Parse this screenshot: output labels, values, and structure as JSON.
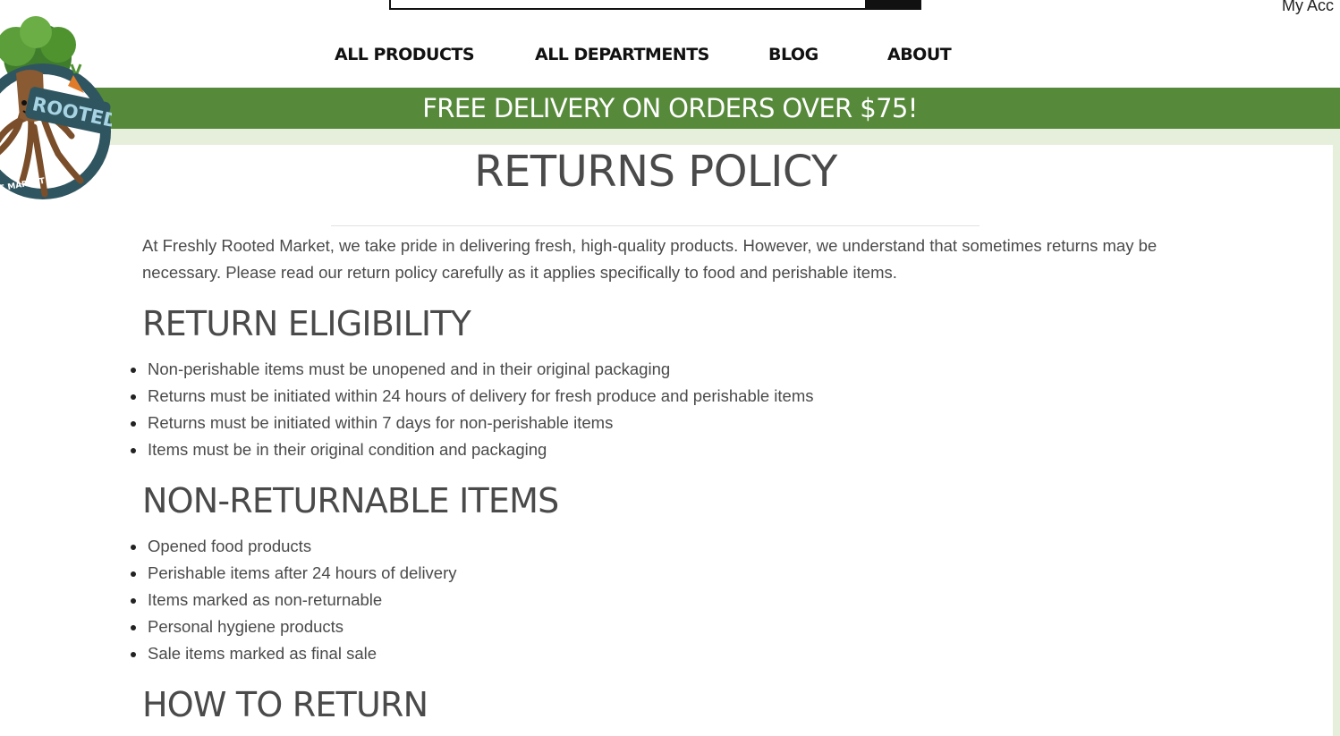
{
  "header": {
    "search_placeholder": "",
    "account_label": "My Acc"
  },
  "logo": {
    "text_main": "ROOTED",
    "text_ring": "NE MARKET"
  },
  "nav": {
    "items": [
      {
        "label": "ALL PRODUCTS"
      },
      {
        "label": "ALL DEPARTMENTS"
      },
      {
        "label": "BLOG"
      },
      {
        "label": "ABOUT"
      }
    ]
  },
  "banner": {
    "text": "FREE DELIVERY ON ORDERS OVER $75!"
  },
  "colors": {
    "banner_green": "#568a3a",
    "light_green": "#e6efdc",
    "text": "#4a4a4a"
  },
  "main": {
    "title": "RETURNS POLICY",
    "intro": "At Freshly Rooted Market, we take pride in delivering fresh, high-quality products. However, we understand that sometimes returns may be necessary. Please read our return policy carefully as it applies specifically to food and perishable items.",
    "sections": [
      {
        "heading": "RETURN ELIGIBILITY",
        "items": [
          "Non-perishable items must be unopened and in their original packaging",
          "Returns must be initiated within 24 hours of delivery for fresh produce and perishable items",
          "Returns must be initiated within 7 days for non-perishable items",
          "Items must be in their original condition and packaging"
        ]
      },
      {
        "heading": "NON-RETURNABLE ITEMS",
        "items": [
          "Opened food products",
          "Perishable items after 24 hours of delivery",
          "Items marked as non-returnable",
          "Personal hygiene products",
          "Sale items marked as final sale"
        ]
      },
      {
        "heading": "HOW TO RETURN",
        "items": []
      }
    ]
  }
}
